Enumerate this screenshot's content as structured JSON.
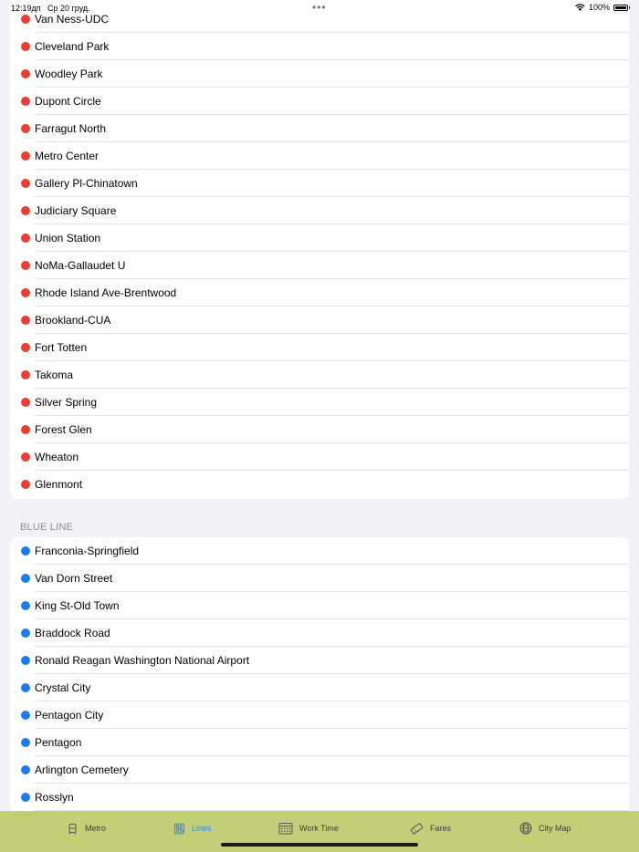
{
  "status_bar": {
    "time": "12:19дп",
    "date": "Ср 20 груд.",
    "dots": "•••",
    "battery": "100%"
  },
  "red_line": {
    "color": "#f23b30",
    "stations": [
      "Van Ness-UDC",
      "Cleveland Park",
      "Woodley Park",
      "Dupont Circle",
      "Farragut North",
      "Metro Center",
      "Gallery Pl-Chinatown",
      "Judiciary Square",
      "Union Station",
      "NoMa-Gallaudet U",
      "Rhode Island Ave-Brentwood",
      "Brookland-CUA",
      "Fort Totten",
      "Takoma",
      "Silver Spring",
      "Forest Glen",
      "Wheaton",
      "Glenmont"
    ]
  },
  "blue_line": {
    "header": "BLUE LINE",
    "color": "#1a7cf2",
    "stations": [
      "Franconia-Springfield",
      "Van Dorn Street",
      "King St-Old Town",
      "Braddock Road",
      "Ronald Reagan Washington National Airport",
      "Crystal City",
      "Pentagon City",
      "Pentagon",
      "Arlington Cemetery",
      "Rosslyn"
    ]
  },
  "tab_bar": {
    "background": "#c2cf76",
    "active_color": "#2f8af5",
    "tabs": [
      {
        "label": "Metro",
        "icon": "train-icon"
      },
      {
        "label": "Lines",
        "icon": "lines-icon",
        "active": true
      },
      {
        "label": "Work Time",
        "icon": "calendar-icon"
      },
      {
        "label": "Fares",
        "icon": "ticket-icon"
      },
      {
        "label": "City Map",
        "icon": "globe-icon"
      }
    ]
  }
}
